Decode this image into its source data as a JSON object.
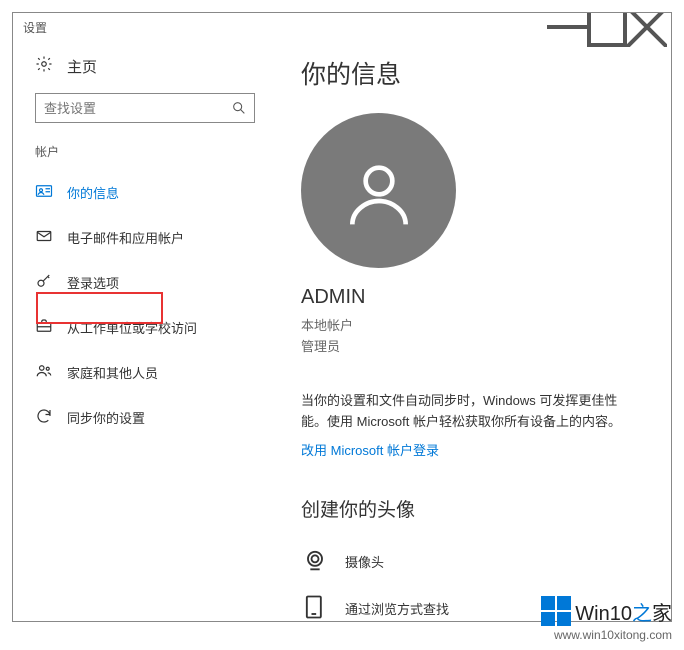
{
  "window": {
    "title": "设置"
  },
  "sidebar": {
    "home": "主页",
    "searchPlaceholder": "查找设置",
    "category": "帐户",
    "items": [
      {
        "label": "你的信息"
      },
      {
        "label": "电子邮件和应用帐户"
      },
      {
        "label": "登录选项"
      },
      {
        "label": "从工作单位或学校访问"
      },
      {
        "label": "家庭和其他人员"
      },
      {
        "label": "同步你的设置"
      }
    ]
  },
  "main": {
    "pageTitle": "你的信息",
    "userName": "ADMIN",
    "accountType": "本地帐户",
    "role": "管理员",
    "desc1": "当你的设置和文件自动同步时，Windows 可发挥更佳性能。使用 Microsoft 帐户轻松获取你所有设备上的内容。",
    "msLink": "改用 Microsoft 帐户登录",
    "avatarSection": "创建你的头像",
    "camera": "摄像头",
    "browse": "通过浏览方式查找"
  },
  "watermark": {
    "brand": "Win10",
    "suffixZhi": "之",
    "suffixJia": "家",
    "url": "www.win10xitong.com"
  }
}
